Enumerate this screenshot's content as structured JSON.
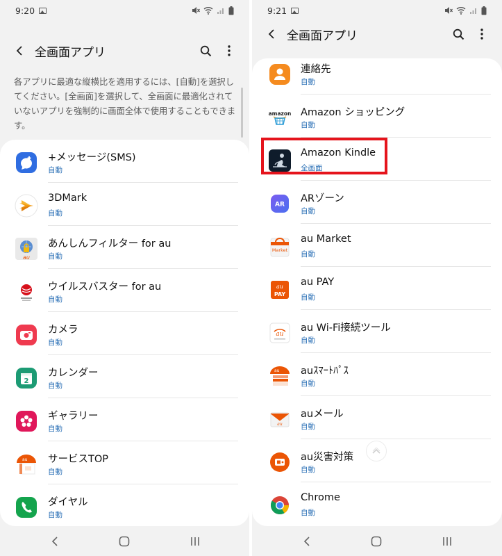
{
  "screens": {
    "left": {
      "statusbar": {
        "time": "9:20"
      },
      "appbar": {
        "title": "全画面アプリ"
      },
      "description": "各アプリに最適な縦横比を適用するには、[自動]を選択してください。[全画面]を選択して、全画面に最適化されていないアプリを強制的に画面全体で使用することもできます。",
      "apps": [
        {
          "name": "+メッセージ(SMS)",
          "status": "自動",
          "icon": "plus-message-icon"
        },
        {
          "name": "3DMark",
          "status": "自動",
          "icon": "3dmark-icon"
        },
        {
          "name": "あんしんフィルター for au",
          "status": "自動",
          "icon": "anshin-filter-icon"
        },
        {
          "name": "ウイルスバスター for au",
          "status": "自動",
          "icon": "virusbuster-icon"
        },
        {
          "name": "カメラ",
          "status": "自動",
          "icon": "camera-icon"
        },
        {
          "name": "カレンダー",
          "status": "自動",
          "icon": "calendar-icon"
        },
        {
          "name": "ギャラリー",
          "status": "自動",
          "icon": "gallery-icon"
        },
        {
          "name": "サービスTOP",
          "status": "自動",
          "icon": "service-top-icon"
        },
        {
          "name": "ダイヤル",
          "status": "自動",
          "icon": "dialer-icon"
        }
      ]
    },
    "right": {
      "statusbar": {
        "time": "9:21"
      },
      "appbar": {
        "title": "全画面アプリ"
      },
      "apps": [
        {
          "name": "連絡先",
          "status": "自動",
          "icon": "contacts-icon"
        },
        {
          "name": "Amazon ショッピング",
          "status": "自動",
          "icon": "amazon-shopping-icon"
        },
        {
          "name": "Amazon Kindle",
          "status": "全画面",
          "icon": "kindle-icon"
        },
        {
          "name": "ARゾーン",
          "status": "自動",
          "icon": "ar-zone-icon"
        },
        {
          "name": "au Market",
          "status": "自動",
          "icon": "au-market-icon"
        },
        {
          "name": "au PAY",
          "status": "自動",
          "icon": "au-pay-icon"
        },
        {
          "name": "au Wi-Fi接続ツール",
          "status": "自動",
          "icon": "au-wifi-icon"
        },
        {
          "name": "auｽﾏｰﾄﾊﾟｽ",
          "status": "自動",
          "icon": "au-smartpass-icon"
        },
        {
          "name": "auメール",
          "status": "自動",
          "icon": "au-mail-icon"
        },
        {
          "name": "au災害対策",
          "status": "自動",
          "icon": "au-disaster-icon"
        },
        {
          "name": "Chrome",
          "status": "自動",
          "icon": "chrome-icon"
        }
      ]
    }
  },
  "icon_text": {
    "ar": "AR",
    "amazon": "amazon",
    "market": "Market",
    "pay": "PAY",
    "cal": "2"
  },
  "colors": {
    "status_blue": "#2e72b7",
    "highlight_red": "#e5141c",
    "au_orange": "#eb5505"
  }
}
